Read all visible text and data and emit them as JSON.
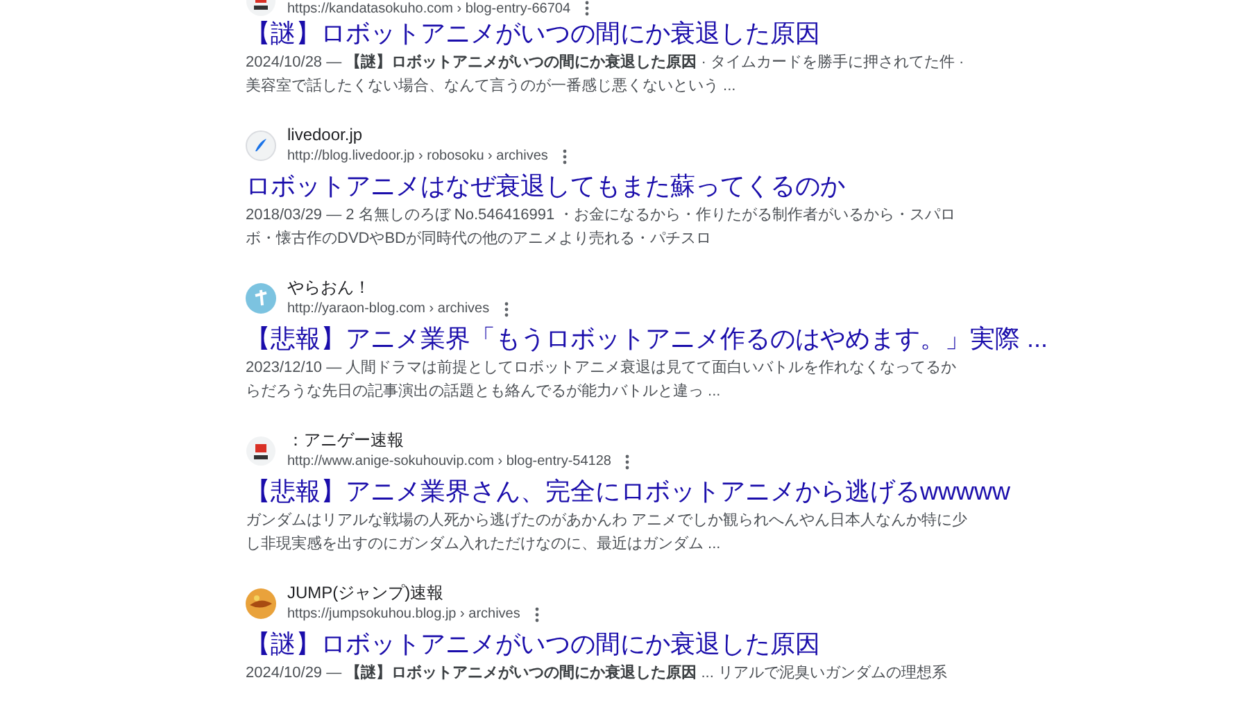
{
  "results": [
    {
      "kind": "fc2",
      "url": "https://kandatasokuho.com › blog-entry-66704",
      "title": "【謎】ロボットアニメがいつの間にか衰退した原因",
      "snippet": "2024/10/28 — **【謎】ロボットアニメがいつの間にか衰退した原因** · タイムカードを勝手に押されてた件 · 美容室で話したくない場合、なんて言うのが一番感じ悪くないという ..."
    },
    {
      "kind": "livedoor",
      "site": "livedoor.jp",
      "url": "http://blog.livedoor.jp › robosoku › archives",
      "title": "ロボットアニメはなぜ衰退してもまた蘇ってくるのか",
      "snippet": "2018/03/29 — 2 名無しのろぼ No.546416991 ・お金になるから・作りたがる制作者がいるから・スパロボ・懐古作のDVDやBDが同時代の他のアニメより売れる・パチスロ"
    },
    {
      "kind": "yaraon",
      "site": "やらおん！",
      "url": "http://yaraon-blog.com › archives",
      "title": "【悲報】アニメ業界「もうロボットアニメ作るのはやめます。」実際 ...",
      "snippet": "2023/12/10 — 人間ドラマは前提としてロボットアニメ衰退は見てて面白いバトルを作れなくなってるからだろうな先日の記事演出の話題とも絡んでるが能力バトルと違っ ..."
    },
    {
      "kind": "fc2",
      "site": "：アニゲー速報",
      "url": "http://www.anige-sokuhouvip.com › blog-entry-54128",
      "title": "【悲報】アニメ業界さん、完全にロボットアニメから逃げるwwwww",
      "snippet": "ガンダムはリアルな戦場の人死から逃げたのがあかんわ アニメでしか観られへんやん日本人なんか特に少し非現実感を出すのにガンダム入れただけなのに、最近はガンダム ..."
    },
    {
      "kind": "jump",
      "site": "JUMP(ジャンプ)速報",
      "url": "https://jumpsokuhou.blog.jp › archives",
      "title": "【謎】ロボットアニメがいつの間にか衰退した原因",
      "snippet": "2024/10/29 — **【謎】ロボットアニメがいつの間にか衰退した原因** ... リアルで泥臭いガンダムの理想系"
    }
  ]
}
